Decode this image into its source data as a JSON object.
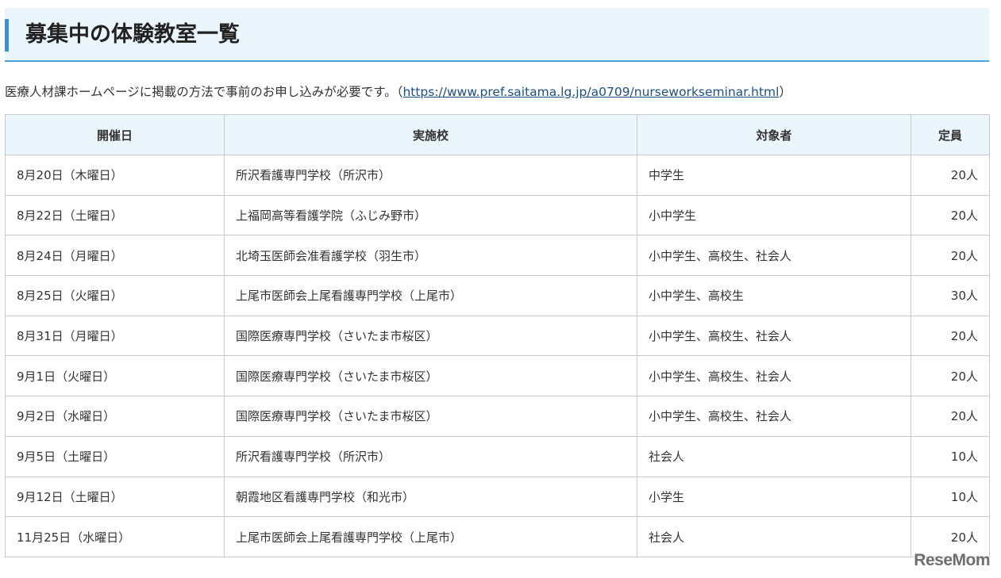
{
  "heading": {
    "title": "募集中の体験教室一覧"
  },
  "intro": {
    "text_before": "医療人材課ホームページに掲載の方法で事前のお申し込みが必要です。（",
    "link_text": "https://www.pref.saitama.lg.jp/a0709/nurseworkseminar.html",
    "text_after": "）"
  },
  "table": {
    "headers": [
      "開催日",
      "実施校",
      "対象者",
      "定員"
    ],
    "rows": [
      [
        "8月20日（木曜日）",
        "所沢看護専門学校（所沢市）",
        "中学生",
        "20人"
      ],
      [
        "8月22日（土曜日）",
        "上福岡高等看護学院（ふじみ野市）",
        "小中学生",
        "20人"
      ],
      [
        "8月24日（月曜日）",
        "北埼玉医師会准看護学校（羽生市）",
        "小中学生、高校生、社会人",
        "20人"
      ],
      [
        "8月25日（火曜日）",
        "上尾市医師会上尾看護専門学校（上尾市）",
        "小中学生、高校生",
        "30人"
      ],
      [
        "8月31日（月曜日）",
        "国際医療専門学校（さいたま市桜区）",
        "小中学生、高校生、社会人",
        "20人"
      ],
      [
        "9月1日（火曜日）",
        "国際医療専門学校（さいたま市桜区）",
        "小中学生、高校生、社会人",
        "20人"
      ],
      [
        "9月2日（水曜日）",
        "国際医療専門学校（さいたま市桜区）",
        "小中学生、高校生、社会人",
        "20人"
      ],
      [
        "9月5日（土曜日）",
        "所沢看護専門学校（所沢市）",
        "社会人",
        "10人"
      ],
      [
        "9月12日（土曜日）",
        "朝霞地区看護専門学校（和光市）",
        "小学生",
        "10人"
      ],
      [
        "11月25日（水曜日）",
        "上尾市医師会上尾看護専門学校（上尾市）",
        "社会人",
        "20人"
      ]
    ]
  },
  "watermark": {
    "logo_text": "ReseMom"
  },
  "colors": {
    "heading_background": "#eaf5fc",
    "heading_accent": "#3d8fcf",
    "heading_underline": "#4aa3d8",
    "link": "#1a4f8b",
    "table_border": "#c9c9c9"
  }
}
